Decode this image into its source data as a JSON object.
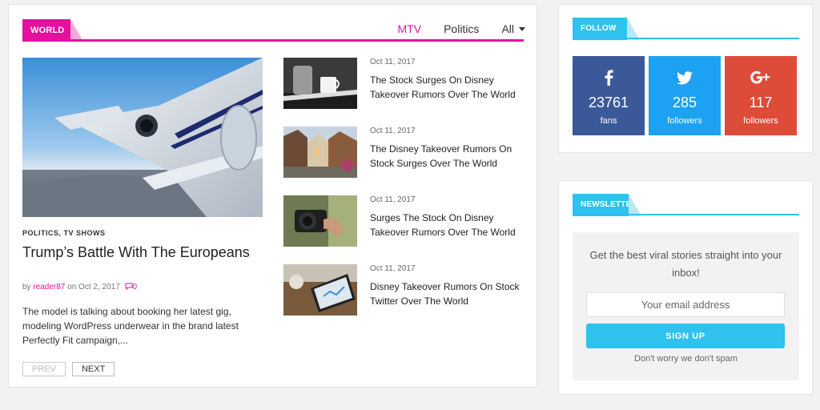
{
  "world": {
    "tag": "WORLD",
    "tabs": [
      {
        "label": "MTV"
      },
      {
        "label": "Politics"
      },
      {
        "label": "All"
      }
    ],
    "featured": {
      "categories": "POLITICS, TV SHOWS",
      "title": "Trump’s Battle With The Europeans",
      "by": "by",
      "author": "reader87",
      "on": "on Oct 2, 2017",
      "comments": "0",
      "excerpt": "The model is talking about booking her latest gig, modeling WordPress underwear in the brand latest Perfectly Fit campaign,..."
    },
    "list": [
      {
        "date": "Oct 11, 2017",
        "title": "The Stock Surges On Disney Takeover Rumors Over The World"
      },
      {
        "date": "Oct 11, 2017",
        "title": "The Disney Takeover Rumors On Stock Surges Over The World"
      },
      {
        "date": "Oct 11, 2017",
        "title": "Surges The Stock On Disney Takeover Rumors Over The World"
      },
      {
        "date": "Oct 11, 2017",
        "title": "Disney Takeover Rumors On Stock Twitter Over The World"
      }
    ],
    "pager": {
      "prev": "PREV",
      "next": "NEXT"
    }
  },
  "follow": {
    "tag": "FOLLOW US",
    "facebook": {
      "count": "23761",
      "unit": "fans",
      "color": "#3b5998"
    },
    "twitter": {
      "count": "285",
      "unit": "followers",
      "color": "#1da1f2"
    },
    "google": {
      "count": "117",
      "unit": "followers",
      "color": "#dd4b39"
    }
  },
  "newsletter": {
    "tag": "NEWSLETTER",
    "text": "Get the best viral stories straight into your inbox!",
    "placeholder": "Your email address",
    "button": "SIGN UP",
    "note": "Don't worry we don't spam"
  },
  "colors": {
    "accent": "#e5109f",
    "secondary": "#2fc2ef"
  }
}
